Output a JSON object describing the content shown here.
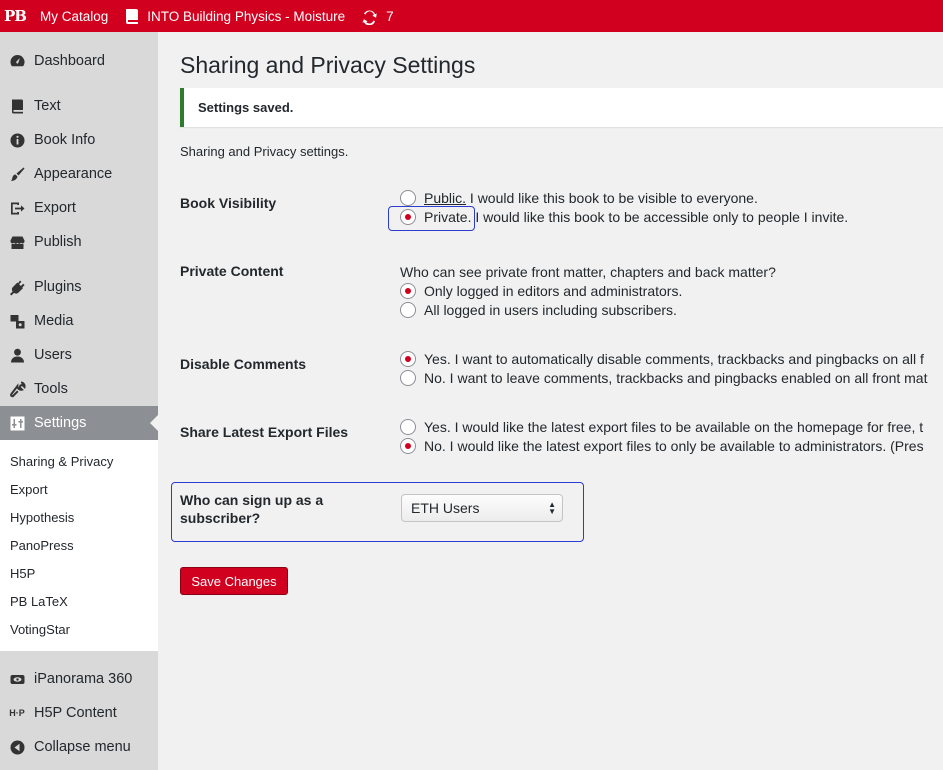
{
  "adminbar": {
    "logo": "PB",
    "catalog": "My Catalog",
    "book": "INTO Building Physics - Moisture",
    "updates": "7"
  },
  "sidebar": {
    "items": [
      {
        "label": "Dashboard",
        "icon": "dashboard-icon"
      },
      {
        "label": "Text",
        "icon": "book-icon"
      },
      {
        "label": "Book Info",
        "icon": "info-icon"
      },
      {
        "label": "Appearance",
        "icon": "brush-icon"
      },
      {
        "label": "Export",
        "icon": "export-icon"
      },
      {
        "label": "Publish",
        "icon": "store-icon"
      },
      {
        "label": "Plugins",
        "icon": "plug-icon"
      },
      {
        "label": "Media",
        "icon": "media-icon"
      },
      {
        "label": "Users",
        "icon": "user-icon"
      },
      {
        "label": "Tools",
        "icon": "wrench-icon"
      },
      {
        "label": "Settings",
        "icon": "settings-icon"
      }
    ],
    "submenu": [
      "Sharing & Privacy",
      "Export",
      "Hypothesis",
      "PanoPress",
      "H5P",
      "PB LaTeX",
      "VotingStar"
    ],
    "bottom_items": [
      {
        "label": "iPanorama 360",
        "icon": "panorama-icon"
      },
      {
        "label": "H5P Content",
        "icon": "h5p-icon",
        "icon_text": "H·P"
      },
      {
        "label": "Collapse menu",
        "icon": "collapse-icon"
      }
    ]
  },
  "main": {
    "title": "Sharing and Privacy Settings",
    "notice": "Settings saved.",
    "intro": "Sharing and Privacy settings.",
    "book_visibility": {
      "label": "Book Visibility",
      "options": [
        {
          "strong": "Public.",
          "text": " I would like this book to be visible to everyone.",
          "checked": false
        },
        {
          "strong": "Private.",
          "text": " I would like this book to be accessible only to people I invite.",
          "checked": true
        }
      ]
    },
    "private_content": {
      "label": "Private Content",
      "question": "Who can see private front matter, chapters and back matter?",
      "options": [
        {
          "text": "Only logged in editors and administrators.",
          "checked": true
        },
        {
          "text": "All logged in users including subscribers.",
          "checked": false
        }
      ]
    },
    "disable_comments": {
      "label": "Disable Comments",
      "options": [
        {
          "text": "Yes. I want to automatically disable comments, trackbacks and pingbacks on all f",
          "checked": true
        },
        {
          "text": "No. I want to leave comments, trackbacks and pingbacks enabled on all front mat",
          "checked": false
        }
      ]
    },
    "share_export": {
      "label": "Share Latest Export Files",
      "options": [
        {
          "text": "Yes. I would like the latest export files to be available on the homepage for free, t",
          "checked": false
        },
        {
          "text": "No. I would like the latest export files to only be available to administrators. (Pres",
          "checked": true
        }
      ]
    },
    "signup": {
      "label_line1": "Who can sign up as a",
      "label_line2": "subscriber?",
      "selected": "ETH Users"
    },
    "save_label": "Save Changes"
  },
  "colors": {
    "brand": "#d2001f",
    "focus": "#2c3cd0",
    "notice_border": "#2d7d2d"
  }
}
